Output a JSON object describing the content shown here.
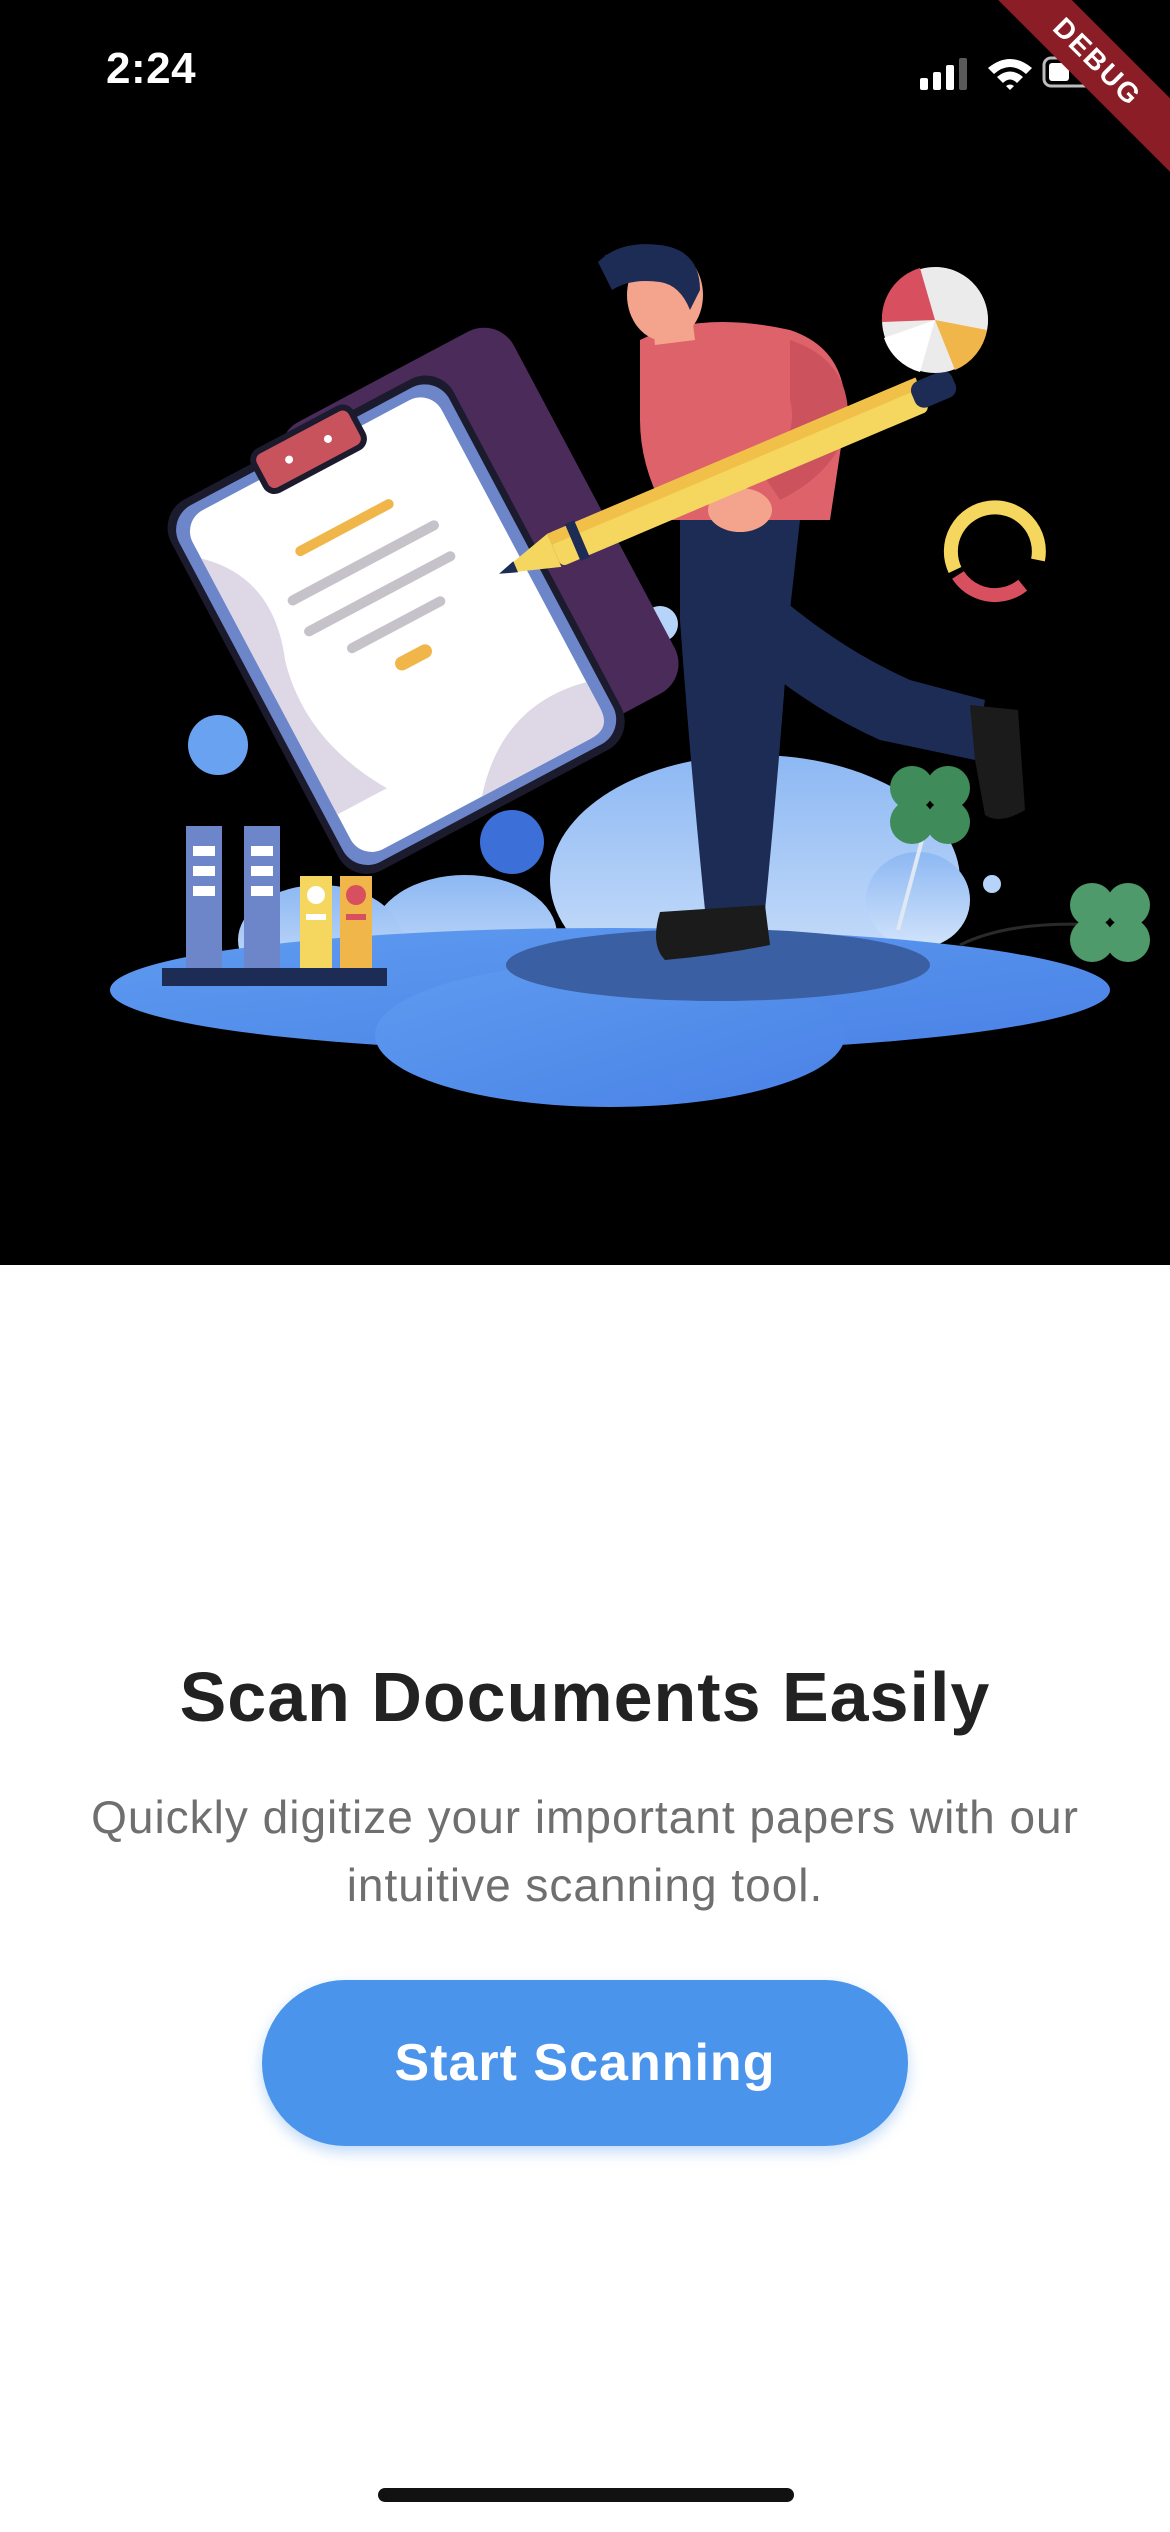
{
  "status_bar": {
    "time": "2:24",
    "debug_label": "DEBUG"
  },
  "onboarding": {
    "title": "Scan Documents Easily",
    "subtitle": "Quickly digitize your important papers with our intuitive scanning tool.",
    "cta_label": "Start Scanning"
  },
  "icons": {
    "signal": "cellular-signal-icon",
    "wifi": "wifi-icon",
    "battery": "battery-icon"
  },
  "colors": {
    "accent": "#4a94ec",
    "hero_background": "#000000",
    "title_text": "#222222",
    "subtitle_text": "#6f6f6f",
    "debug_banner": "#8b1d27"
  }
}
